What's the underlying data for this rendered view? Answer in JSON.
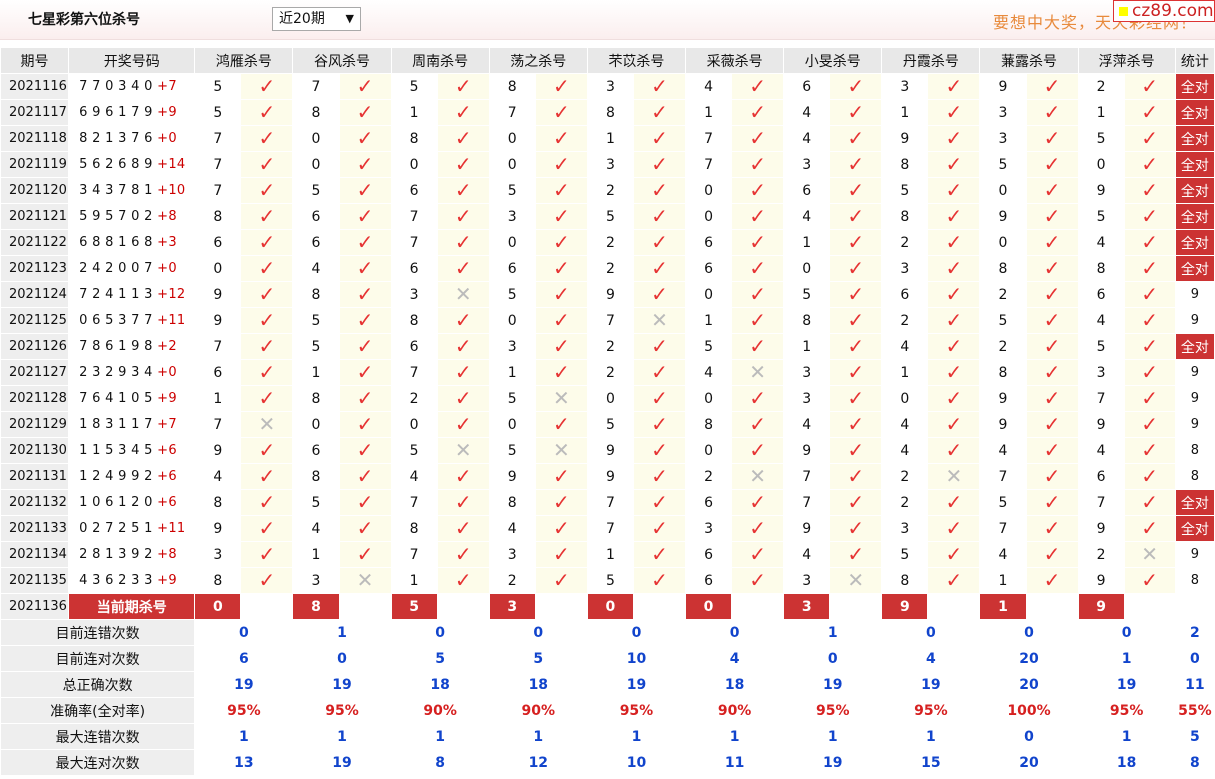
{
  "header": {
    "title": "七星彩第六位杀号",
    "period_select": "近20期",
    "slogan": "要想中大奖，天天彩经网！",
    "logo": "cz89.com"
  },
  "table": {
    "columns": {
      "period": "期号",
      "numbers": "开奖号码",
      "stat": "统计"
    },
    "experts": [
      "鸿雁杀号",
      "谷风杀号",
      "周南杀号",
      "荡之杀号",
      "芣苡杀号",
      "采薇杀号",
      "小旻杀号",
      "丹霞杀号",
      "蒹露杀号",
      "浮萍杀号"
    ],
    "rows": [
      {
        "p": "2021116",
        "n": "7 7 0 3 4 0",
        "s": "+7",
        "k": [
          "5",
          "7",
          "5",
          "8",
          "3",
          "4",
          "6",
          "3",
          "9",
          "2"
        ],
        "r": [
          1,
          1,
          1,
          1,
          1,
          1,
          1,
          1,
          1,
          1
        ],
        "st": "全对"
      },
      {
        "p": "2021117",
        "n": "6 9 6 1 7 9",
        "s": "+9",
        "k": [
          "5",
          "8",
          "1",
          "7",
          "8",
          "1",
          "4",
          "1",
          "3",
          "1"
        ],
        "r": [
          1,
          1,
          1,
          1,
          1,
          1,
          1,
          1,
          1,
          1
        ],
        "st": "全对"
      },
      {
        "p": "2021118",
        "n": "8 2 1 3 7 6",
        "s": "+0",
        "k": [
          "7",
          "0",
          "8",
          "0",
          "1",
          "7",
          "4",
          "9",
          "3",
          "5"
        ],
        "r": [
          1,
          1,
          1,
          1,
          1,
          1,
          1,
          1,
          1,
          1
        ],
        "st": "全对"
      },
      {
        "p": "2021119",
        "n": "5 6 2 6 8 9",
        "s": "+14",
        "k": [
          "7",
          "0",
          "0",
          "0",
          "3",
          "7",
          "3",
          "8",
          "5",
          "0"
        ],
        "r": [
          1,
          1,
          1,
          1,
          1,
          1,
          1,
          1,
          1,
          1
        ],
        "st": "全对"
      },
      {
        "p": "2021120",
        "n": "3 4 3 7 8 1",
        "s": "+10",
        "k": [
          "7",
          "5",
          "6",
          "5",
          "2",
          "0",
          "6",
          "5",
          "0",
          "9"
        ],
        "r": [
          1,
          1,
          1,
          1,
          1,
          1,
          1,
          1,
          1,
          1
        ],
        "st": "全对"
      },
      {
        "p": "2021121",
        "n": "5 9 5 7 0 2",
        "s": "+8",
        "k": [
          "8",
          "6",
          "7",
          "3",
          "5",
          "0",
          "4",
          "8",
          "9",
          "5"
        ],
        "r": [
          1,
          1,
          1,
          1,
          1,
          1,
          1,
          1,
          1,
          1
        ],
        "st": "全对"
      },
      {
        "p": "2021122",
        "n": "6 8 8 1 6 8",
        "s": "+3",
        "k": [
          "6",
          "6",
          "7",
          "0",
          "2",
          "6",
          "1",
          "2",
          "0",
          "4"
        ],
        "r": [
          1,
          1,
          1,
          1,
          1,
          1,
          1,
          1,
          1,
          1
        ],
        "st": "全对"
      },
      {
        "p": "2021123",
        "n": "2 4 2 0 0 7",
        "s": "+0",
        "k": [
          "0",
          "4",
          "6",
          "6",
          "2",
          "6",
          "0",
          "3",
          "8",
          "8"
        ],
        "r": [
          1,
          1,
          1,
          1,
          1,
          1,
          1,
          1,
          1,
          1
        ],
        "st": "全对"
      },
      {
        "p": "2021124",
        "n": "7 2 4 1 1 3",
        "s": "+12",
        "k": [
          "9",
          "8",
          "3",
          "5",
          "9",
          "0",
          "5",
          "6",
          "2",
          "6"
        ],
        "r": [
          1,
          1,
          0,
          1,
          1,
          1,
          1,
          1,
          1,
          1
        ],
        "st": "9"
      },
      {
        "p": "2021125",
        "n": "0 6 5 3 7 7",
        "s": "+11",
        "k": [
          "9",
          "5",
          "8",
          "0",
          "7",
          "1",
          "8",
          "2",
          "5",
          "4"
        ],
        "r": [
          1,
          1,
          1,
          1,
          0,
          1,
          1,
          1,
          1,
          1
        ],
        "st": "9"
      },
      {
        "p": "2021126",
        "n": "7 8 6 1 9 8",
        "s": "+2",
        "k": [
          "7",
          "5",
          "6",
          "3",
          "2",
          "5",
          "1",
          "4",
          "2",
          "5"
        ],
        "r": [
          1,
          1,
          1,
          1,
          1,
          1,
          1,
          1,
          1,
          1
        ],
        "st": "全对"
      },
      {
        "p": "2021127",
        "n": "2 3 2 9 3 4",
        "s": "+0",
        "k": [
          "6",
          "1",
          "7",
          "1",
          "2",
          "4",
          "3",
          "1",
          "8",
          "3"
        ],
        "r": [
          1,
          1,
          1,
          1,
          1,
          0,
          1,
          1,
          1,
          1
        ],
        "st": "9"
      },
      {
        "p": "2021128",
        "n": "7 6 4 1 0 5",
        "s": "+9",
        "k": [
          "1",
          "8",
          "2",
          "5",
          "0",
          "0",
          "3",
          "0",
          "9",
          "7"
        ],
        "r": [
          1,
          1,
          1,
          0,
          1,
          1,
          1,
          1,
          1,
          1
        ],
        "st": "9"
      },
      {
        "p": "2021129",
        "n": "1 8 3 1 1 7",
        "s": "+7",
        "k": [
          "7",
          "0",
          "0",
          "0",
          "5",
          "8",
          "4",
          "4",
          "9",
          "9"
        ],
        "r": [
          0,
          1,
          1,
          1,
          1,
          1,
          1,
          1,
          1,
          1
        ],
        "st": "9"
      },
      {
        "p": "2021130",
        "n": "1 1 5 3 4 5",
        "s": "+6",
        "k": [
          "9",
          "6",
          "5",
          "5",
          "9",
          "0",
          "9",
          "4",
          "4",
          "4"
        ],
        "r": [
          1,
          1,
          0,
          0,
          1,
          1,
          1,
          1,
          1,
          1
        ],
        "st": "8"
      },
      {
        "p": "2021131",
        "n": "1 2 4 9 9 2",
        "s": "+6",
        "k": [
          "4",
          "8",
          "4",
          "9",
          "9",
          "2",
          "7",
          "2",
          "7",
          "6"
        ],
        "r": [
          1,
          1,
          1,
          1,
          1,
          0,
          1,
          0,
          1,
          1
        ],
        "st": "8"
      },
      {
        "p": "2021132",
        "n": "1 0 6 1 2 0",
        "s": "+6",
        "k": [
          "8",
          "5",
          "7",
          "8",
          "7",
          "6",
          "7",
          "2",
          "5",
          "7"
        ],
        "r": [
          1,
          1,
          1,
          1,
          1,
          1,
          1,
          1,
          1,
          1
        ],
        "st": "全对"
      },
      {
        "p": "2021133",
        "n": "0 2 7 2 5 1",
        "s": "+11",
        "k": [
          "9",
          "4",
          "8",
          "4",
          "7",
          "3",
          "9",
          "3",
          "7",
          "9"
        ],
        "r": [
          1,
          1,
          1,
          1,
          1,
          1,
          1,
          1,
          1,
          1
        ],
        "st": "全对"
      },
      {
        "p": "2021134",
        "n": "2 8 1 3 9 2",
        "s": "+8",
        "k": [
          "3",
          "1",
          "7",
          "3",
          "1",
          "6",
          "4",
          "5",
          "4",
          "2"
        ],
        "r": [
          1,
          1,
          1,
          1,
          1,
          1,
          1,
          1,
          1,
          0
        ],
        "st": "9"
      },
      {
        "p": "2021135",
        "n": "4 3 6 2 3 3",
        "s": "+9",
        "k": [
          "8",
          "3",
          "1",
          "2",
          "5",
          "6",
          "3",
          "8",
          "1",
          "9"
        ],
        "r": [
          1,
          0,
          1,
          1,
          1,
          1,
          0,
          1,
          1,
          1
        ],
        "st": "8"
      }
    ],
    "current": {
      "p": "2021136",
      "label": "当前期杀号",
      "k": [
        "0",
        "8",
        "5",
        "3",
        "0",
        "0",
        "3",
        "9",
        "1",
        "9"
      ]
    },
    "summary": [
      {
        "label": "目前连错次数",
        "v": [
          "0",
          "1",
          "0",
          "0",
          "0",
          "0",
          "1",
          "0",
          "0",
          "0"
        ],
        "stat": "2"
      },
      {
        "label": "目前连对次数",
        "v": [
          "6",
          "0",
          "5",
          "5",
          "10",
          "4",
          "0",
          "4",
          "20",
          "1"
        ],
        "stat": "0"
      },
      {
        "label": "总正确次数",
        "v": [
          "19",
          "19",
          "18",
          "18",
          "19",
          "18",
          "19",
          "19",
          "20",
          "19"
        ],
        "stat": "11"
      },
      {
        "label": "准确率(全对率)",
        "v": [
          "95%",
          "95%",
          "90%",
          "90%",
          "95%",
          "90%",
          "95%",
          "95%",
          "100%",
          "95%"
        ],
        "stat": "55%",
        "red": true
      },
      {
        "label": "最大连错次数",
        "v": [
          "1",
          "1",
          "1",
          "1",
          "1",
          "1",
          "1",
          "1",
          "0",
          "1"
        ],
        "stat": "5"
      },
      {
        "label": "最大连对次数",
        "v": [
          "13",
          "19",
          "8",
          "12",
          "10",
          "11",
          "19",
          "15",
          "20",
          "18"
        ],
        "stat": "8"
      }
    ]
  }
}
